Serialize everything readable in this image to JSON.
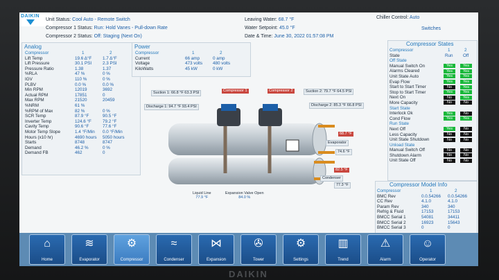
{
  "header": {
    "unit_status_label": "Unit Status:",
    "unit_status_value": "Cool Auto - Remote Switch",
    "comp1_status_label": "Compressor 1 Status:",
    "comp1_status_value": "Run: Hold Vanes - Pull-down Rate",
    "comp2_status_label": "Compressor 2 Status:",
    "comp2_status_value": "Off: Staging (Next On)",
    "leaving_water_label": "Leaving Water:",
    "leaving_water_value": "68.7 °F",
    "water_setpoint_label": "Water Setpoint:",
    "water_setpoint_value": "45.0 °F",
    "datetime_label": "Date & Time:",
    "datetime_value": "June 30, 2022  01:57:08 PM",
    "chiller_control_label": "Chiller Control:",
    "chiller_control_value": "Auto",
    "switches_label": "Switches",
    "brand": "DAIKIN"
  },
  "analog": {
    "title": "Analog",
    "col_label": "Compressor",
    "col1": "1",
    "col2": "2",
    "rows": [
      {
        "label": "Lift Temp",
        "v1": "19.6 Δ°F",
        "v2": "1.7 Δ°F"
      },
      {
        "label": "Lift Pressure",
        "v1": "30.1 PSI",
        "v2": "2.3 PSI"
      },
      {
        "label": "Pressure Ratio",
        "v1": "1.38",
        "v2": "1.37"
      },
      {
        "label": "%RLA",
        "v1": "47 %",
        "v2": "0 %"
      },
      {
        "label": "IGV",
        "v1": "110 %",
        "v2": "0 %"
      },
      {
        "label": "PLBV",
        "v1": "0.0 %",
        "v2": "0.0 %"
      },
      {
        "label": "Min RPM",
        "v1": "12019",
        "v2": "3692"
      },
      {
        "label": "Actual RPM",
        "v1": "17851",
        "v2": "0"
      },
      {
        "label": "Max RPM",
        "v1": "21520",
        "v2": "20459"
      },
      {
        "label": "%NRM",
        "v1": "61 %",
        "v2": ""
      },
      {
        "label": "%RPM of Max",
        "v1": "82 %",
        "v2": "0 %"
      },
      {
        "label": "SCR Temp",
        "v1": "87.9 °F",
        "v2": "90.5 °F"
      },
      {
        "label": "Inverter Temp",
        "v1": "124.6 °F",
        "v2": "79.2 °F"
      },
      {
        "label": "Cavity Temp",
        "v1": "90.6 °F",
        "v2": "77.6 °F"
      },
      {
        "label": "Motor Temp Slope",
        "v1": "1.4 °F/Min",
        "v2": "0.0 °F/Min"
      },
      {
        "label": "Hours (x10 hr)",
        "v1": "4690 hours",
        "v2": "5050 hours"
      },
      {
        "label": "Starts",
        "v1": "8748",
        "v2": "8747"
      },
      {
        "label": "Demand",
        "v1": "46.2 %",
        "v2": "0 %"
      },
      {
        "label": "Demand FB",
        "v1": "462",
        "v2": "0"
      }
    ]
  },
  "power": {
    "title": "Power",
    "col_label": "Compressor",
    "col1": "1",
    "col2": "2",
    "rows": [
      {
        "label": "Current",
        "v1": "66 amp",
        "v2": "0 amp"
      },
      {
        "label": "Voltage",
        "v1": "473 volts",
        "v2": "480 volts"
      },
      {
        "label": "KiloWatts",
        "v1": "45 kW",
        "v2": "0 kW"
      }
    ]
  },
  "diagram": {
    "suction1": "Suction 1:  66.8 °F 63.3 PSI",
    "discharge1": "Discharge 1:  94.7 °F 93.4 PSI",
    "compressor1": "Compressor 1",
    "compressor2": "Compressor 2",
    "suction2": "Suction 2:  79.7 °F 64.5 PSI",
    "discharge2": "Discharge 2:  85.3 °F 66.8 PSI",
    "evap_out": "68.7 °F",
    "evaporator": "Evaporator",
    "evap_in": "74.6 °F",
    "cond_in": "82.5 °F",
    "condenser": "Condenser",
    "cond_out": "77.3 °F",
    "liquid_line_label": "Liquid Line",
    "liquid_line_value": "77.9 °F",
    "expansion_label": "Expansion Valve Open",
    "expansion_value": "84.0 %"
  },
  "comp_states": {
    "title": "Compressor States",
    "col_label": "Compressor",
    "col1": "1",
    "col2": "2",
    "state_label": "State",
    "state1": "Run",
    "state2": "Off",
    "off_state_title": "Off State",
    "off_rows": [
      {
        "label": "Manual Switch On",
        "v1": "Yes",
        "v2": "Yes"
      },
      {
        "label": "Alarms Cleared",
        "v1": "Yes",
        "v2": "Yes"
      },
      {
        "label": "Unit State Auto",
        "v1": "Yes",
        "v2": "Yes"
      },
      {
        "label": "Evap Flow",
        "v1": "Yes",
        "v2": "Yes"
      },
      {
        "label": "Start to Start Timer",
        "v1": "No",
        "v2": "Yes"
      },
      {
        "label": "Stop to Start Timer",
        "v1": "Yes",
        "v2": "Yes"
      },
      {
        "label": "Next On",
        "v1": "No",
        "v2": "Yes"
      },
      {
        "label": "More Capacity",
        "v1": "No",
        "v2": "No"
      }
    ],
    "start_state_title": "Start State",
    "start_rows": [
      {
        "label": "Interlock Ok",
        "v1": "Yes",
        "v2": "No"
      },
      {
        "label": "Cond Flow",
        "v1": "Yes",
        "v2": "Yes"
      }
    ],
    "run_state_title": "Run State",
    "run_rows": [
      {
        "label": "Next Off",
        "v1": "Yes",
        "v2": "No"
      },
      {
        "label": "Less Capacity",
        "v1": "No",
        "v2": "No"
      },
      {
        "label": "Unit State Shutdown",
        "v1": "No",
        "v2": "No"
      }
    ],
    "unload_state_title": "Unload State",
    "unload_rows": [
      {
        "label": "Manual Switch Off",
        "v1": "No",
        "v2": "No"
      },
      {
        "label": "Shutdown Alarm",
        "v1": "No",
        "v2": "No"
      },
      {
        "label": "Unit State Off",
        "v1": "No",
        "v2": "No"
      }
    ]
  },
  "model_info": {
    "title": "Compressor Model Info",
    "col_label": "Compressor",
    "col1": "1",
    "col2": "2",
    "rows": [
      {
        "label": "BMC Rev",
        "v1": "0.0.54266",
        "v2": "0.0.54266"
      },
      {
        "label": "CC Rev",
        "v1": "4.1.0",
        "v2": "4.1.0"
      },
      {
        "label": "Param Rev",
        "v1": "340",
        "v2": "340"
      },
      {
        "label": "Refrig & Fluid",
        "v1": "17153",
        "v2": "17153"
      },
      {
        "label": "BMCC Serial 1",
        "v1": "54081",
        "v2": "34411"
      },
      {
        "label": "BMCC Serial 2",
        "v1": "16923",
        "v2": "15643"
      },
      {
        "label": "BMCC Serial 3",
        "v1": "0",
        "v2": "0"
      }
    ]
  },
  "nav": [
    {
      "label": "Home",
      "icon": "home-icon",
      "glyph": "⌂"
    },
    {
      "label": "Evaporator",
      "icon": "evaporator-icon",
      "glyph": "≋"
    },
    {
      "label": "Compressor",
      "icon": "compressor-icon",
      "glyph": "⚙"
    },
    {
      "label": "Condenser",
      "icon": "condenser-icon",
      "glyph": "≈"
    },
    {
      "label": "Expansion",
      "icon": "expansion-icon",
      "glyph": "⋈"
    },
    {
      "label": "Tower",
      "icon": "tower-icon",
      "glyph": "✇"
    },
    {
      "label": "Settings",
      "icon": "settings-icon",
      "glyph": "⚙"
    },
    {
      "label": "Trend",
      "icon": "trend-icon",
      "glyph": "▥"
    },
    {
      "label": "Alarm",
      "icon": "alarm-icon",
      "glyph": "⚠"
    },
    {
      "label": "Operator",
      "icon": "operator-icon",
      "glyph": "☺"
    }
  ],
  "colors": {
    "accent": "#2277bb",
    "yes": "#18b83a",
    "no": "#111111",
    "nav": "#1b4d88"
  }
}
